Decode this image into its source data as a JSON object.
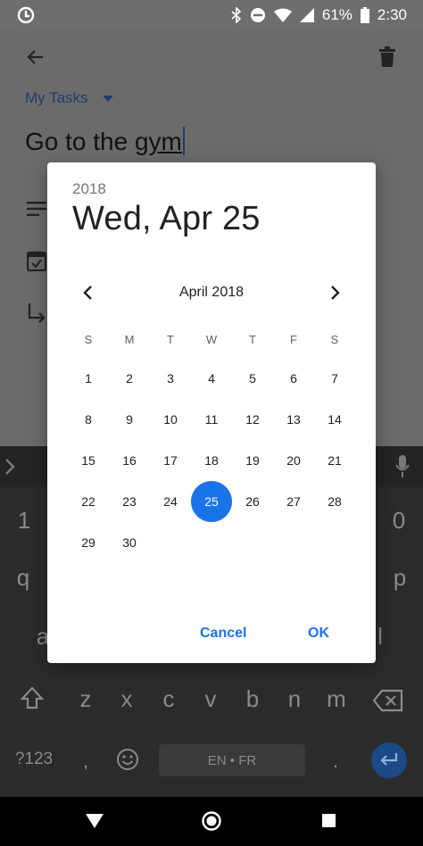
{
  "status_bar": {
    "battery": "61%",
    "time": "2:30",
    "icons": [
      "app-notification-icon",
      "bluetooth-icon",
      "do-not-disturb-icon",
      "wifi-icon",
      "signal-icon",
      "battery-icon"
    ]
  },
  "app": {
    "list_name": "My Tasks",
    "task_title_prefix": "Go to the ",
    "task_title_word": "gym"
  },
  "dialog": {
    "year": "2018",
    "selected_date": "Wed, Apr 25",
    "month_label": "April 2018",
    "weekdays": [
      "S",
      "M",
      "T",
      "W",
      "T",
      "F",
      "S"
    ],
    "weeks": [
      [
        "",
        "",
        "",
        "",
        "",
        "",
        ""
      ],
      [
        "1",
        "2",
        "3",
        "4",
        "5",
        "6",
        "7"
      ],
      [
        "8",
        "9",
        "10",
        "11",
        "12",
        "13",
        "14"
      ],
      [
        "15",
        "16",
        "17",
        "18",
        "19",
        "20",
        "21"
      ],
      [
        "22",
        "23",
        "24",
        "25",
        "26",
        "27",
        "28"
      ],
      [
        "29",
        "30",
        "",
        "",
        "",
        "",
        ""
      ]
    ],
    "selected_day": "25",
    "cancel_label": "Cancel",
    "ok_label": "OK",
    "accent_color": "#1a73e8"
  },
  "keyboard": {
    "number_row_left": "1",
    "number_row_right": "0",
    "q_key": "q",
    "p_key": "p",
    "a_key": "a",
    "l_key": "l",
    "bottom_letters": [
      "z",
      "x",
      "c",
      "v",
      "b",
      "n",
      "m"
    ],
    "symbols_key": "?123",
    "comma_key": ",",
    "period_key": ".",
    "space_label": "EN • FR"
  }
}
